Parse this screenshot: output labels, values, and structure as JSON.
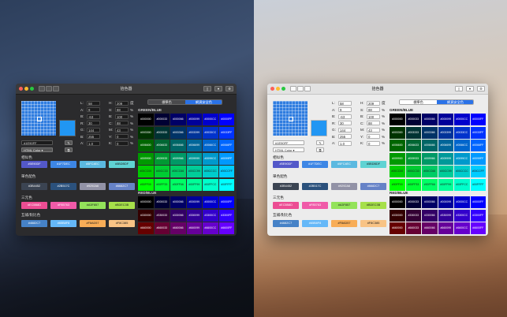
{
  "window": {
    "title": "拾色器"
  },
  "segment": {
    "standard": "標準色",
    "web_safe": "網頁安全色"
  },
  "picker": {
    "hex": "#1E90FF",
    "format": "HTML Color",
    "preview_color": "#2196f3"
  },
  "fields": [
    {
      "label": "L:",
      "value": "58"
    },
    {
      "label": "A:",
      "value": "9"
    },
    {
      "label": "B:",
      "value": "-63"
    },
    {
      "label": "R:",
      "value": "30"
    },
    {
      "label": "G:",
      "value": "144"
    },
    {
      "label": "B:",
      "value": "255"
    },
    {
      "label": "A:",
      "value": "1.0"
    }
  ],
  "fields2": [
    {
      "label": "H:",
      "value": "209",
      "unit": "度"
    },
    {
      "label": "S:",
      "value": "88",
      "unit": "%"
    },
    {
      "label": "B:",
      "value": "100",
      "unit": "%"
    },
    {
      "label": "C:",
      "value": "88",
      "unit": "%"
    },
    {
      "label": "M:",
      "value": "43",
      "unit": "%"
    },
    {
      "label": "Y:",
      "value": "0",
      "unit": "%"
    },
    {
      "label": "K:",
      "value": "0",
      "unit": "%"
    }
  ],
  "sections": {
    "similar": "相似色",
    "complementary": "單色配色",
    "triad": "三元色",
    "tetrad": "互補/對比色"
  },
  "similar_chips": [
    {
      "label": "#5E90DF",
      "bg": "#5358c9",
      "fg": "#ffffff"
    },
    {
      "label": "#1F7DEC",
      "bg": "#3d86e5",
      "fg": "#ffffff"
    },
    {
      "label": "#5FC4EC",
      "bg": "#5bb9e0",
      "fg": "#ffffff"
    },
    {
      "label": "#5BDBDF",
      "bg": "#5fd3d3",
      "fg": "#1b1b1b"
    }
  ],
  "mono_chips": [
    {
      "label": "#3B4452",
      "bg": "#3b4452",
      "fg": "#ffffff"
    },
    {
      "label": "#2B517C",
      "bg": "#2b517c",
      "fg": "#ffffff"
    },
    {
      "label": "#9292A6",
      "bg": "#9292a6",
      "fg": "#ffffff"
    },
    {
      "label": "#6682C7",
      "bg": "#6682c7",
      "fg": "#ffffff"
    }
  ],
  "triad_chips": [
    {
      "label": "#EC5B8D",
      "bg": "#ec4d93",
      "fg": "#ffffff"
    },
    {
      "label": "#F85763",
      "bg": "#f05aa8",
      "fg": "#ffffff"
    },
    {
      "label": "#A3F857",
      "bg": "#93e35a",
      "fg": "#1b1b1b"
    },
    {
      "label": "#BDEC3B",
      "bg": "#a6e04a",
      "fg": "#1b1b1b"
    }
  ],
  "tetrad_chips": [
    {
      "label": "#4682C7",
      "bg": "#4682c7",
      "fg": "#ffffff"
    },
    {
      "label": "#65B8F8",
      "bg": "#65b8f8",
      "fg": "#ffffff"
    },
    {
      "label": "#F8AD57",
      "bg": "#f8ad57",
      "fg": "#1b1b1b"
    },
    {
      "label": "#F8C385",
      "bg": "#f8c385",
      "fg": "#1b1b1b"
    }
  ],
  "green_blue_title": "GREEN/BLUE",
  "red_blue_title": "RED/BLUE",
  "green_blue_rows": [
    {
      "labels": [
        "#000000",
        "#000033",
        "#000066",
        "#000099",
        "#0000CC",
        "#0000FF"
      ],
      "colors": [
        "#000000",
        "#000033",
        "#000066",
        "#000099",
        "#0000cc",
        "#0000ff"
      ]
    },
    {
      "labels": [
        "#003300",
        "#003333",
        "#003366",
        "#003399",
        "#0033CC",
        "#0033FF"
      ],
      "colors": [
        "#003300",
        "#003333",
        "#003366",
        "#003399",
        "#0033cc",
        "#0033ff"
      ]
    },
    {
      "labels": [
        "#006600",
        "#006633",
        "#006666",
        "#006699",
        "#0066CC",
        "#0066FF"
      ],
      "colors": [
        "#006600",
        "#006633",
        "#006666",
        "#006699",
        "#0066cc",
        "#0066ff"
      ]
    },
    {
      "labels": [
        "#009900",
        "#009933",
        "#009966",
        "#009999",
        "#0099CC",
        "#0099FF"
      ],
      "colors": [
        "#009900",
        "#009933",
        "#009966",
        "#009999",
        "#0099cc",
        "#0099ff"
      ]
    },
    {
      "labels": [
        "#00CC00",
        "#00CC33",
        "#00CC66",
        "#00CC99",
        "#00CCCC",
        "#00CCFF"
      ],
      "colors": [
        "#00cc00",
        "#00cc33",
        "#00cc66",
        "#00cc99",
        "#00cccc",
        "#00ccff"
      ]
    },
    {
      "labels": [
        "#00FF00",
        "#00FF33",
        "#00FF66",
        "#00FF99",
        "#00FFCC",
        "#00FFFF"
      ],
      "colors": [
        "#00ff00",
        "#00ff33",
        "#00ff66",
        "#00ff99",
        "#00ffcc",
        "#00ffff"
      ]
    }
  ],
  "red_blue_rows": [
    {
      "labels": [
        "#000000",
        "#000033",
        "#000066",
        "#000099",
        "#0000CC",
        "#0000FF"
      ],
      "colors": [
        "#000000",
        "#000033",
        "#000066",
        "#000099",
        "#0000cc",
        "#0000ff"
      ]
    },
    {
      "labels": [
        "#330000",
        "#330033",
        "#330066",
        "#330099",
        "#3300CC",
        "#3300FF"
      ],
      "colors": [
        "#330000",
        "#330033",
        "#330066",
        "#330099",
        "#3300cc",
        "#3300ff"
      ]
    },
    {
      "labels": [
        "#660000",
        "#660033",
        "#660066",
        "#660099",
        "#6600CC",
        "#6600FF"
      ],
      "colors": [
        "#660000",
        "#660033",
        "#660066",
        "#660099",
        "#6600cc",
        "#6600ff"
      ]
    }
  ]
}
